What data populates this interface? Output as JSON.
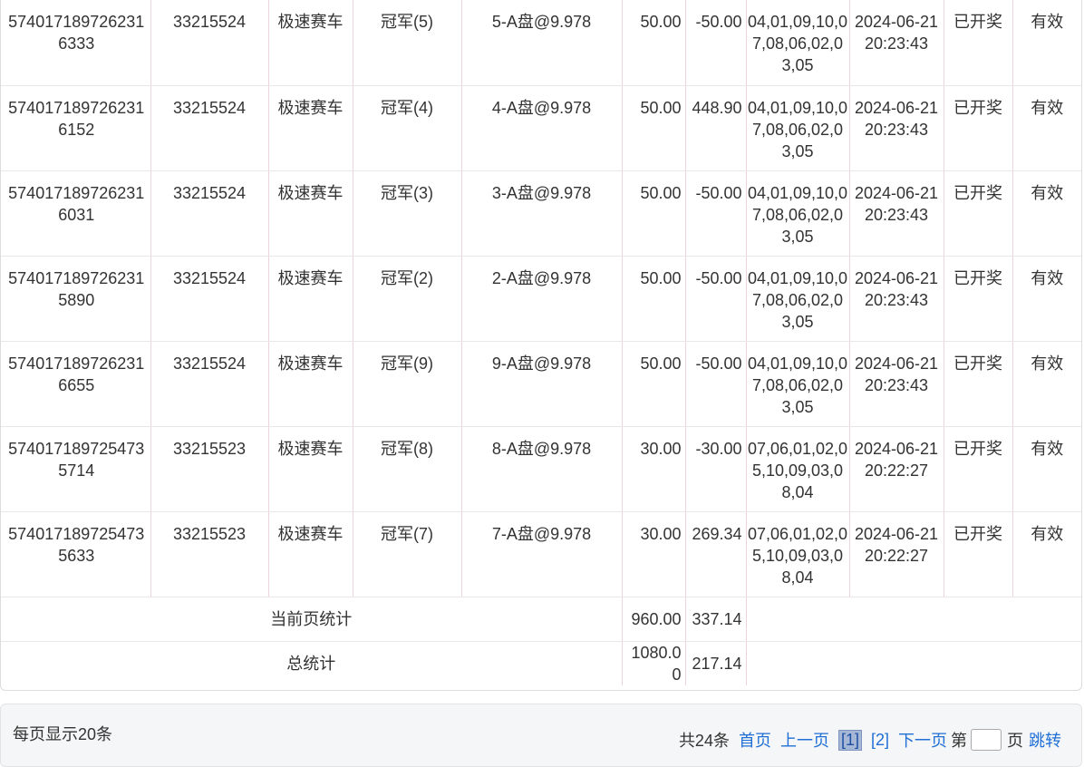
{
  "rows": [
    {
      "order_no": "5740171897262316333",
      "issue": "33215524",
      "game": "极速赛车",
      "play": "冠军(5)",
      "content": "5-A盘@9.978",
      "amount": "50.00",
      "win": "-50.00",
      "result": "04,01,09,10,07,08,06,02,03,05",
      "time": "2024-06-21 20:23:43",
      "status": "已开奖",
      "valid": "有效"
    },
    {
      "order_no": "5740171897262316152",
      "issue": "33215524",
      "game": "极速赛车",
      "play": "冠军(4)",
      "content": "4-A盘@9.978",
      "amount": "50.00",
      "win": "448.90",
      "result": "04,01,09,10,07,08,06,02,03,05",
      "time": "2024-06-21 20:23:43",
      "status": "已开奖",
      "valid": "有效"
    },
    {
      "order_no": "5740171897262316031",
      "issue": "33215524",
      "game": "极速赛车",
      "play": "冠军(3)",
      "content": "3-A盘@9.978",
      "amount": "50.00",
      "win": "-50.00",
      "result": "04,01,09,10,07,08,06,02,03,05",
      "time": "2024-06-21 20:23:43",
      "status": "已开奖",
      "valid": "有效"
    },
    {
      "order_no": "5740171897262315890",
      "issue": "33215524",
      "game": "极速赛车",
      "play": "冠军(2)",
      "content": "2-A盘@9.978",
      "amount": "50.00",
      "win": "-50.00",
      "result": "04,01,09,10,07,08,06,02,03,05",
      "time": "2024-06-21 20:23:43",
      "status": "已开奖",
      "valid": "有效"
    },
    {
      "order_no": "5740171897262316655",
      "issue": "33215524",
      "game": "极速赛车",
      "play": "冠军(9)",
      "content": "9-A盘@9.978",
      "amount": "50.00",
      "win": "-50.00",
      "result": "04,01,09,10,07,08,06,02,03,05",
      "time": "2024-06-21 20:23:43",
      "status": "已开奖",
      "valid": "有效"
    },
    {
      "order_no": "5740171897254735714",
      "issue": "33215523",
      "game": "极速赛车",
      "play": "冠军(8)",
      "content": "8-A盘@9.978",
      "amount": "30.00",
      "win": "-30.00",
      "result": "07,06,01,02,05,10,09,03,08,04",
      "time": "2024-06-21 20:22:27",
      "status": "已开奖",
      "valid": "有效"
    },
    {
      "order_no": "5740171897254735633",
      "issue": "33215523",
      "game": "极速赛车",
      "play": "冠军(7)",
      "content": "7-A盘@9.978",
      "amount": "30.00",
      "win": "269.34",
      "result": "07,06,01,02,05,10,09,03,08,04",
      "time": "2024-06-21 20:22:27",
      "status": "已开奖",
      "valid": "有效"
    }
  ],
  "stats": {
    "page_label": "当前页统计",
    "page_amount": "960.00",
    "page_win": "337.14",
    "total_label": "总统计",
    "total_amount": "1080.00",
    "total_win": "217.14"
  },
  "pager": {
    "page_size_text": "每页显示20条",
    "total_text": "共24条",
    "first": "首页",
    "prev": "上一页",
    "current": "[1]",
    "page2": "[2]",
    "next": "下一页",
    "goto_prefix": "第",
    "goto_suffix": "页",
    "jump": "跳转",
    "goto_value": ""
  },
  "colors": {
    "link": "#1f6fd6",
    "current_page_bg": "#a7b8d6",
    "border_pink": "#ecd4d8"
  }
}
